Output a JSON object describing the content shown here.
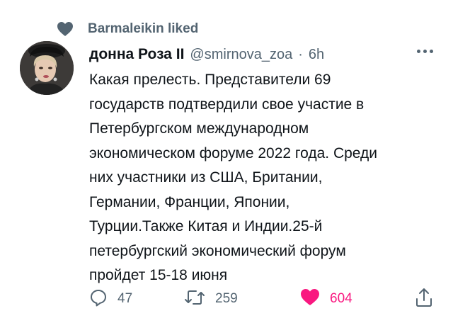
{
  "social_context": {
    "text": "Barmaleikin liked",
    "icon": "heart-icon"
  },
  "tweet": {
    "author_name": "донна Роза II",
    "handle": "@smirnova_zoa",
    "separator": "·",
    "time": "6h",
    "text": "Какая прелесть. Представители 69\nгосударств подтвердили свое участие в\nПетербургском международном\nэкономическом форуме 2022 года. Среди\nних участники из США, Британии,\nГермании, Франции, Японии,\nТурции.Также Китая и Индии.25-й\nпетербургский экономический форум\nпройдет 15-18 июня"
  },
  "actions": {
    "replies": "47",
    "retweets": "259",
    "likes": "604",
    "liked": true
  },
  "colors": {
    "text": "#0f1419",
    "secondary": "#536471",
    "like": "#f91880"
  }
}
